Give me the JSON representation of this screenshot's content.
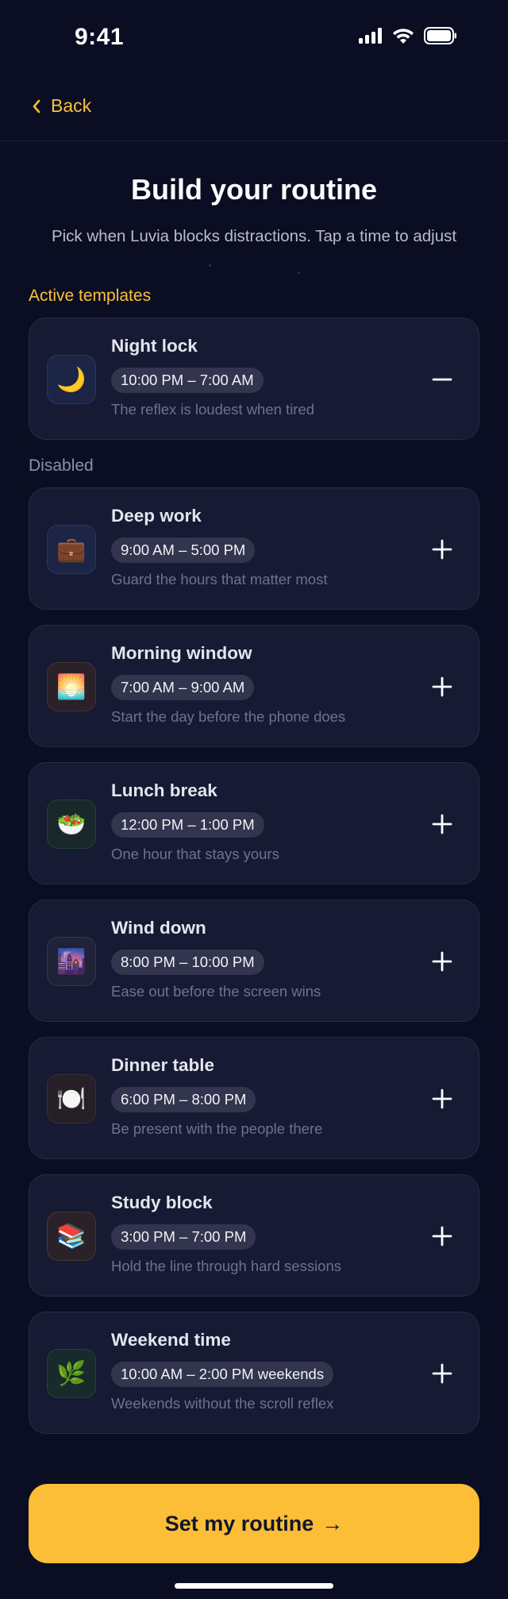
{
  "status": {
    "time": "9:41"
  },
  "nav": {
    "back_label": "Back"
  },
  "header": {
    "title": "Build your routine",
    "subtitle": "Pick when Luvia blocks distractions. Tap a time to adjust"
  },
  "sections": {
    "active_label": "Active templates",
    "disabled_label": "Disabled"
  },
  "active": [
    {
      "name": "Night lock",
      "time": "10:00 PM – 7:00 AM",
      "desc": "The reflex is loudest when tired",
      "icon": "🌙",
      "icon_name": "moon-icon",
      "tint": "#1d2546",
      "border": "#2a3566"
    }
  ],
  "disabled": [
    {
      "name": "Deep work",
      "time": "9:00 AM – 5:00 PM",
      "desc": "Guard the hours that matter most",
      "icon": "💼",
      "icon_name": "briefcase-icon",
      "tint": "#1d2546",
      "border": "#2a3566"
    },
    {
      "name": "Morning window",
      "time": "7:00 AM – 9:00 AM",
      "desc": "Start the day before the phone does",
      "icon": "🌅",
      "icon_name": "sunrise-icon",
      "tint": "#2b2129",
      "border": "#4a3033"
    },
    {
      "name": "Lunch break",
      "time": "12:00 PM – 1:00 PM",
      "desc": "One hour that stays yours",
      "icon": "🥗",
      "icon_name": "salad-icon",
      "tint": "#19282b",
      "border": "#25423a"
    },
    {
      "name": "Wind down",
      "time": "8:00 PM – 10:00 PM",
      "desc": "Ease out before the screen wins",
      "icon": "🌆",
      "icon_name": "city-dusk-icon",
      "tint": "#1f2238",
      "border": "#343856"
    },
    {
      "name": "Dinner table",
      "time": "6:00 PM – 8:00 PM",
      "desc": "Be present with the people there",
      "icon": "🍽️",
      "icon_name": "plate-cutlery-icon",
      "tint": "#261f27",
      "border": "#3a2e34"
    },
    {
      "name": "Study block",
      "time": "3:00 PM – 7:00 PM",
      "desc": "Hold the line through hard sessions",
      "icon": "📚",
      "icon_name": "books-icon",
      "tint": "#2a2129",
      "border": "#4a3533"
    },
    {
      "name": "Weekend time",
      "time": "10:00 AM – 2:00 PM weekends",
      "desc": "Weekends without the scroll reflex",
      "icon": "🌿",
      "icon_name": "herb-icon",
      "tint": "#182a2b",
      "border": "#22453b"
    }
  ],
  "cta": {
    "label": "Set my routine",
    "arrow": "→"
  },
  "colors": {
    "accent": "#fcbd37",
    "background": "#0b0e22",
    "card": "#161a33"
  }
}
